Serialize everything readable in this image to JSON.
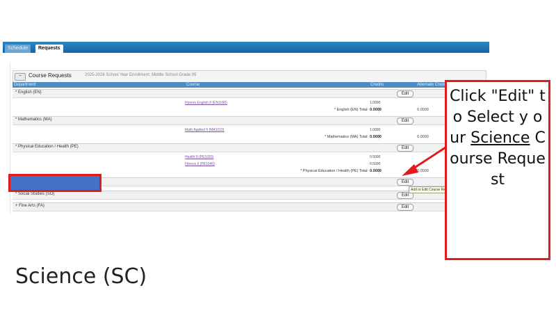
{
  "tabs": [
    {
      "label": "Schedule"
    },
    {
      "label": "Requests"
    }
  ],
  "course_requests": {
    "collapse_label": "−",
    "title": "Course Requests",
    "meta": "2025-2026 School Year   Enrollment: Middle School   Grade 09"
  },
  "columns": {
    "department": "Department",
    "course": "Course",
    "credits": "Credits",
    "alternate": "Alternate Credits"
  },
  "departments": [
    {
      "name": "* English (EN)",
      "edit": "Edit"
    },
    {
      "name": "* Mathematics (MA)",
      "edit": "Edit"
    },
    {
      "name": "* Physical Education / Health (PE)",
      "edit": "Edit"
    },
    {
      "name": "",
      "edit": "Edit"
    },
    {
      "name": "* Social Studies (SO)",
      "edit": "Edit"
    },
    {
      "name": "+ Fine Arts (FA)",
      "edit": "Edit"
    }
  ],
  "courses": {
    "english": [
      {
        "name": "Honors English 9 (EN1030)",
        "credits": "1.0000"
      }
    ],
    "math": [
      {
        "name": "Math Applied 9 (MA1010)",
        "credits": "1.0000"
      }
    ],
    "pe": [
      {
        "name": "Health 9 (PE1020)",
        "credits": "0.5000"
      },
      {
        "name": "Fitness 9 (PE1040)",
        "credits": "0.5000"
      }
    ]
  },
  "totals": {
    "english": {
      "label": "* English (EN) Total:",
      "value": "0.0000",
      "alt": "0.0000"
    },
    "math": {
      "label": "* Mathematics (MA) Total:",
      "value": "0.0000",
      "alt": "0.0000"
    },
    "pe": {
      "label": "* Physical Education / Health (PE) Total:",
      "value": "0.0000",
      "alt": "0.0000"
    }
  },
  "tooltip": "Add or Edit Course Requests",
  "callout": {
    "line1": "Click \"Edit\" to Select y our ",
    "underlined": "Science",
    "line2": " Course Request"
  },
  "caption": "Science (SC)",
  "colors": {
    "tab_bar": "#1f78be",
    "highlight_fill": "#4472c4",
    "annotation_red": "#e11b1b"
  }
}
